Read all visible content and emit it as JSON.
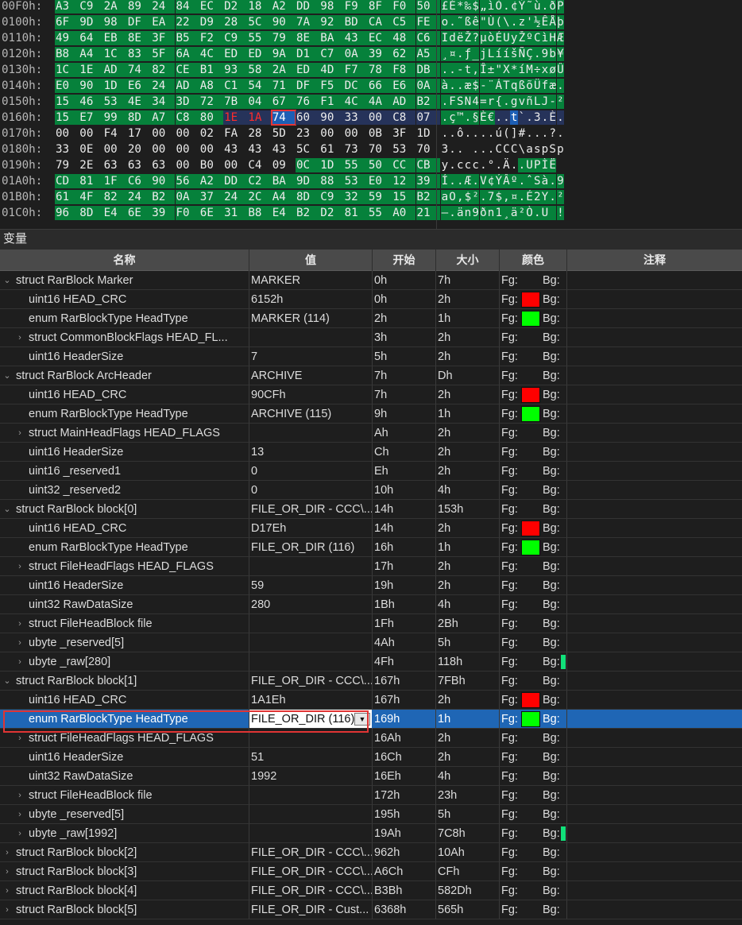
{
  "hex": {
    "rows": [
      {
        "addr": "00F0h:",
        "bytes": [
          "A3",
          "C9",
          "2A",
          "89",
          "24",
          "84",
          "EC",
          "D2",
          "18",
          "A2",
          "DD",
          "98",
          "F9",
          "8F",
          "F0",
          "50"
        ],
        "ascii": "£É*‰$„ìÒ.¢Ý˜ù.ðP",
        "style": "gggggggggggggggg"
      },
      {
        "addr": "0100h:",
        "bytes": [
          "6F",
          "9D",
          "98",
          "DF",
          "EA",
          "22",
          "D9",
          "28",
          "5C",
          "90",
          "7A",
          "92",
          "BD",
          "CA",
          "C5",
          "FE"
        ],
        "ascii": "o.˜ßê\"Ù(\\.z'½ÊÅþ",
        "style": "gggggggggggggggg"
      },
      {
        "addr": "0110h:",
        "bytes": [
          "49",
          "64",
          "EB",
          "8E",
          "3F",
          "B5",
          "F2",
          "C9",
          "55",
          "79",
          "8E",
          "BA",
          "43",
          "EC",
          "48",
          "C6"
        ],
        "ascii": "IdëŽ?µòÉUyŽºCìHÆ",
        "style": "gggggggggggggggg"
      },
      {
        "addr": "0120h:",
        "bytes": [
          "B8",
          "A4",
          "1C",
          "83",
          "5F",
          "6A",
          "4C",
          "ED",
          "ED",
          "9A",
          "D1",
          "C7",
          "0A",
          "39",
          "62",
          "A5"
        ],
        "ascii": "¸¤.ƒ_jLííšÑÇ.9b¥",
        "style": "gggggggggggggggg"
      },
      {
        "addr": "0130h:",
        "bytes": [
          "1C",
          "1E",
          "AD",
          "74",
          "82",
          "CE",
          "B1",
          "93",
          "58",
          "2A",
          "ED",
          "4D",
          "F7",
          "78",
          "F8",
          "DB"
        ],
        "ascii": "..-t‚Î±\"X*íM÷xøÛ",
        "style": "gggggggggggggggg"
      },
      {
        "addr": "0140h:",
        "bytes": [
          "E0",
          "90",
          "1D",
          "E6",
          "24",
          "AD",
          "A8",
          "C1",
          "54",
          "71",
          "DF",
          "F5",
          "DC",
          "66",
          "E6",
          "0A"
        ],
        "ascii": "à..æ$-¨ÁTqßõÜfæ.",
        "style": "gggggggggggggggg"
      },
      {
        "addr": "0150h:",
        "bytes": [
          "15",
          "46",
          "53",
          "4E",
          "34",
          "3D",
          "72",
          "7B",
          "04",
          "67",
          "76",
          "F1",
          "4C",
          "4A",
          "AD",
          "B2"
        ],
        "ascii": ".FSN4=r{.gvñLJ-²",
        "style": "gggggggggggggggg"
      },
      {
        "addr": "0160h:",
        "bytes": [
          "15",
          "E7",
          "99",
          "8D",
          "A7",
          "C8",
          "80",
          "1E",
          "1A",
          "74",
          "60",
          "90",
          "33",
          "00",
          "C8",
          "07"
        ],
        "ascii": ".ç™.§È€..t`.3.È.",
        "style": "gggggggrrsnnnnnn"
      },
      {
        "addr": "0170h:",
        "bytes": [
          "00",
          "00",
          "F4",
          "17",
          "00",
          "00",
          "02",
          "FA",
          "28",
          "5D",
          "23",
          "00",
          "00",
          "0B",
          "3F",
          "1D"
        ],
        "ascii": "..ô....ú(]#...?.",
        "style": "dddddddddddddddd"
      },
      {
        "addr": "0180h:",
        "bytes": [
          "33",
          "0E",
          "00",
          "20",
          "00",
          "00",
          "00",
          "43",
          "43",
          "43",
          "5C",
          "61",
          "73",
          "70",
          "53",
          "70"
        ],
        "ascii": "3.. ...CCC\\aspSp",
        "style": "dddddddddddddddd"
      },
      {
        "addr": "0190h:",
        "bytes": [
          "79",
          "2E",
          "63",
          "63",
          "63",
          "00",
          "B0",
          "00",
          "C4",
          "09",
          "0C",
          "1D",
          "55",
          "50",
          "CC",
          "CB"
        ],
        "ascii": "y.ccc.°.Ä..UPÌË",
        "style": "ddddddddddgggggg"
      },
      {
        "addr": "01A0h:",
        "bytes": [
          "CD",
          "81",
          "1F",
          "C6",
          "90",
          "56",
          "A2",
          "DD",
          "C2",
          "BA",
          "9D",
          "88",
          "53",
          "E0",
          "12",
          "39"
        ],
        "ascii": "Í..Æ.V¢ÝÂº.ˆSà.9",
        "style": "gggggggggggggggg"
      },
      {
        "addr": "01B0h:",
        "bytes": [
          "61",
          "4F",
          "82",
          "24",
          "B2",
          "0A",
          "37",
          "24",
          "2C",
          "A4",
          "8D",
          "C9",
          "32",
          "59",
          "15",
          "B2"
        ],
        "ascii": "aO‚$².7$,¤.É2Y.²",
        "style": "gggggggggggggggg"
      },
      {
        "addr": "01C0h:",
        "bytes": [
          "96",
          "8D",
          "E4",
          "6E",
          "39",
          "F0",
          "6E",
          "31",
          "B8",
          "E4",
          "B2",
          "D2",
          "81",
          "55",
          "A0",
          "21"
        ],
        "ascii": "–.än9ðn1¸ä²Ò.U !",
        "style": "gggggggggggggggg"
      }
    ]
  },
  "panel": {
    "title": "变量",
    "columns": {
      "name": "名称",
      "value": "值",
      "start": "开始",
      "size": "大小",
      "color": "颜色",
      "note": "注释"
    }
  },
  "colors": {
    "red": "#ff0000",
    "green": "#00ff00",
    "selection": "#1f66b5",
    "hex_green": "#06813b"
  },
  "rows": [
    {
      "level": 0,
      "expand": "open",
      "name": "struct RarBlock Marker",
      "value": "MARKER",
      "start": "0h",
      "size": "7h",
      "fg": "",
      "bg": ""
    },
    {
      "level": 1,
      "expand": "",
      "name": "uint16 HEAD_CRC",
      "value": "6152h",
      "start": "0h",
      "size": "2h",
      "fg": "red",
      "bg": ""
    },
    {
      "level": 1,
      "expand": "",
      "name": "enum RarBlockType HeadType",
      "value": "MARKER (114)",
      "start": "2h",
      "size": "1h",
      "fg": "green",
      "bg": ""
    },
    {
      "level": 1,
      "expand": "closed",
      "name": "struct CommonBlockFlags HEAD_FL...",
      "value": "",
      "start": "3h",
      "size": "2h",
      "fg": "",
      "bg": ""
    },
    {
      "level": 1,
      "expand": "",
      "name": "uint16 HeaderSize",
      "value": "7",
      "start": "5h",
      "size": "2h",
      "fg": "",
      "bg": ""
    },
    {
      "level": 0,
      "expand": "open",
      "name": "struct RarBlock ArcHeader",
      "value": "ARCHIVE",
      "start": "7h",
      "size": "Dh",
      "fg": "",
      "bg": ""
    },
    {
      "level": 1,
      "expand": "",
      "name": "uint16 HEAD_CRC",
      "value": "90CFh",
      "start": "7h",
      "size": "2h",
      "fg": "red",
      "bg": ""
    },
    {
      "level": 1,
      "expand": "",
      "name": "enum RarBlockType HeadType",
      "value": "ARCHIVE (115)",
      "start": "9h",
      "size": "1h",
      "fg": "green",
      "bg": ""
    },
    {
      "level": 1,
      "expand": "closed",
      "name": "struct MainHeadFlags HEAD_FLAGS",
      "value": "",
      "start": "Ah",
      "size": "2h",
      "fg": "",
      "bg": ""
    },
    {
      "level": 1,
      "expand": "",
      "name": "uint16 HeaderSize",
      "value": "13",
      "start": "Ch",
      "size": "2h",
      "fg": "",
      "bg": ""
    },
    {
      "level": 1,
      "expand": "",
      "name": "uint16 _reserved1",
      "value": "0",
      "start": "Eh",
      "size": "2h",
      "fg": "",
      "bg": ""
    },
    {
      "level": 1,
      "expand": "",
      "name": "uint32 _reserved2",
      "value": "0",
      "start": "10h",
      "size": "4h",
      "fg": "",
      "bg": ""
    },
    {
      "level": 0,
      "expand": "open",
      "name": "struct RarBlock block[0]",
      "value": "FILE_OR_DIR - CCC\\...",
      "start": "14h",
      "size": "153h",
      "fg": "",
      "bg": ""
    },
    {
      "level": 1,
      "expand": "",
      "name": "uint16 HEAD_CRC",
      "value": "D17Eh",
      "start": "14h",
      "size": "2h",
      "fg": "red",
      "bg": ""
    },
    {
      "level": 1,
      "expand": "",
      "name": "enum RarBlockType HeadType",
      "value": "FILE_OR_DIR (116)",
      "start": "16h",
      "size": "1h",
      "fg": "green",
      "bg": ""
    },
    {
      "level": 1,
      "expand": "closed",
      "name": "struct FileHeadFlags HEAD_FLAGS",
      "value": "",
      "start": "17h",
      "size": "2h",
      "fg": "",
      "bg": ""
    },
    {
      "level": 1,
      "expand": "",
      "name": "uint16 HeaderSize",
      "value": "59",
      "start": "19h",
      "size": "2h",
      "fg": "",
      "bg": ""
    },
    {
      "level": 1,
      "expand": "",
      "name": "uint32 RawDataSize",
      "value": "280",
      "start": "1Bh",
      "size": "4h",
      "fg": "",
      "bg": ""
    },
    {
      "level": 1,
      "expand": "closed",
      "name": "struct FileHeadBlock file",
      "value": "",
      "start": "1Fh",
      "size": "2Bh",
      "fg": "",
      "bg": ""
    },
    {
      "level": 1,
      "expand": "closed",
      "name": "ubyte _reserved[5]",
      "value": "",
      "start": "4Ah",
      "size": "5h",
      "fg": "",
      "bg": ""
    },
    {
      "level": 1,
      "expand": "closed",
      "name": "ubyte _raw[280]",
      "value": "",
      "start": "4Fh",
      "size": "118h",
      "fg": "",
      "bg": "green"
    },
    {
      "level": 0,
      "expand": "open",
      "name": "struct RarBlock block[1]",
      "value": "FILE_OR_DIR - CCC\\...",
      "start": "167h",
      "size": "7FBh",
      "fg": "",
      "bg": ""
    },
    {
      "level": 1,
      "expand": "",
      "name": "uint16 HEAD_CRC",
      "value": "1A1Eh",
      "start": "167h",
      "size": "2h",
      "fg": "red",
      "bg": ""
    },
    {
      "level": 1,
      "expand": "",
      "name": "enum RarBlockType HeadType",
      "value": "FILE_OR_DIR (116)",
      "start": "169h",
      "size": "1h",
      "fg": "green",
      "bg": "",
      "selected": true
    },
    {
      "level": 1,
      "expand": "closed",
      "name": "struct FileHeadFlags HEAD_FLAGS",
      "value": "",
      "start": "16Ah",
      "size": "2h",
      "fg": "",
      "bg": ""
    },
    {
      "level": 1,
      "expand": "",
      "name": "uint16 HeaderSize",
      "value": "51",
      "start": "16Ch",
      "size": "2h",
      "fg": "",
      "bg": ""
    },
    {
      "level": 1,
      "expand": "",
      "name": "uint32 RawDataSize",
      "value": "1992",
      "start": "16Eh",
      "size": "4h",
      "fg": "",
      "bg": ""
    },
    {
      "level": 1,
      "expand": "closed",
      "name": "struct FileHeadBlock file",
      "value": "",
      "start": "172h",
      "size": "23h",
      "fg": "",
      "bg": ""
    },
    {
      "level": 1,
      "expand": "closed",
      "name": "ubyte _reserved[5]",
      "value": "",
      "start": "195h",
      "size": "5h",
      "fg": "",
      "bg": ""
    },
    {
      "level": 1,
      "expand": "closed",
      "name": "ubyte _raw[1992]",
      "value": "",
      "start": "19Ah",
      "size": "7C8h",
      "fg": "",
      "bg": "green"
    },
    {
      "level": 0,
      "expand": "closed",
      "name": "struct RarBlock block[2]",
      "value": "FILE_OR_DIR - CCC\\...",
      "start": "962h",
      "size": "10Ah",
      "fg": "",
      "bg": ""
    },
    {
      "level": 0,
      "expand": "closed",
      "name": "struct RarBlock block[3]",
      "value": "FILE_OR_DIR - CCC\\...",
      "start": "A6Ch",
      "size": "CFh",
      "fg": "",
      "bg": ""
    },
    {
      "level": 0,
      "expand": "closed",
      "name": "struct RarBlock block[4]",
      "value": "FILE_OR_DIR - CCC\\...",
      "start": "B3Bh",
      "size": "582Dh",
      "fg": "",
      "bg": ""
    },
    {
      "level": 0,
      "expand": "closed",
      "name": "struct RarBlock block[5]",
      "value": "FILE_OR_DIR - Cust...",
      "start": "6368h",
      "size": "565h",
      "fg": "",
      "bg": ""
    }
  ],
  "labels": {
    "fg": "Fg:",
    "bg": "Bg:"
  }
}
